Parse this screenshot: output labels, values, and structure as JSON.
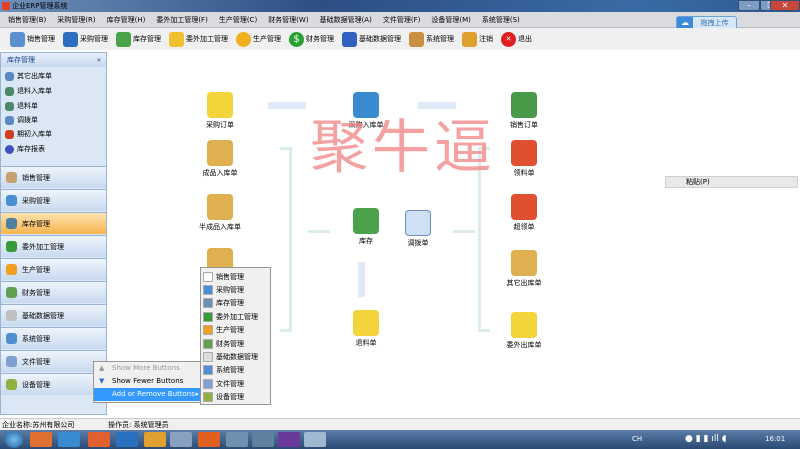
{
  "window": {
    "title": "企业ERP管理系统"
  },
  "menu": [
    "销售管理(B)",
    "采购管理(R)",
    "库存管理(H)",
    "委外加工管理(F)",
    "生产管理(C)",
    "财务管理(W)",
    "基础数据管理(A)",
    "文件管理(F)",
    "设备管理(M)",
    "系统管理(S)"
  ],
  "toolbar": [
    {
      "label": "销售管理",
      "icon": "pencil-doc-icon",
      "color": "#5a8fd0"
    },
    {
      "label": "采购管理",
      "icon": "basket-icon",
      "color": "#2a6fc0"
    },
    {
      "label": "库存管理",
      "icon": "house-icon",
      "color": "#4aa34a"
    },
    {
      "label": "委外加工管理",
      "icon": "folder-arrow-icon",
      "color": "#f0c030"
    },
    {
      "label": "生产管理",
      "icon": "gear-icon",
      "color": "#f0b020"
    },
    {
      "label": "财务管理",
      "icon": "dollar-icon",
      "color": "#2aa030"
    },
    {
      "label": "基础数据管理",
      "icon": "calendar-grid-icon",
      "color": "#3060c0"
    },
    {
      "label": "系统管理",
      "icon": "boxes-tools-icon",
      "color": "#c89040"
    },
    {
      "label": "注销",
      "icon": "key-icon",
      "color": "#e0a030"
    },
    {
      "label": "退出",
      "icon": "close-icon",
      "color": "#e02020"
    }
  ],
  "upload_button": "拖拽上传",
  "left_panel": {
    "title": "库存管理",
    "collapse": "«",
    "items": [
      "其它出库单",
      "退料入库单",
      "退料单",
      "调拨单",
      "期初入库单",
      "库存报表"
    ],
    "nav": [
      "销售管理",
      "采购管理",
      "库存管理",
      "委外加工管理",
      "生产管理",
      "财务管理",
      "基础数据管理",
      "系统管理",
      "文件管理",
      "设备管理"
    ]
  },
  "flow": {
    "purchase_order": "采购订单",
    "finished_in": "成品入库单",
    "semi_in": "半成品入库单",
    "purchase_in": "采购入库单",
    "inventory": "库存",
    "transfer": "调拨单",
    "return_material": "退料单",
    "sales_order": "销售订单",
    "material_req": "领料单",
    "over_req": "超领单",
    "other_out": "其它出库单",
    "outsource_out": "委外出库单"
  },
  "watermark": "聚牛逼",
  "paste_menu": "粘贴(P)",
  "context_menu": [
    "Show More Buttons",
    "Show Fewer Buttons",
    "Add or Remove Buttons"
  ],
  "submenu": [
    "销售管理",
    "采购管理",
    "库存管理",
    "委外加工管理",
    "生产管理",
    "财务管理",
    "基础数据管理",
    "系统管理",
    "文件管理",
    "设备管理"
  ],
  "status": {
    "company": "企业名称:苏州有限公司",
    "operator": "操作员: 系统管理员"
  },
  "taskbar": {
    "lang": "CH",
    "time": "16:01"
  }
}
